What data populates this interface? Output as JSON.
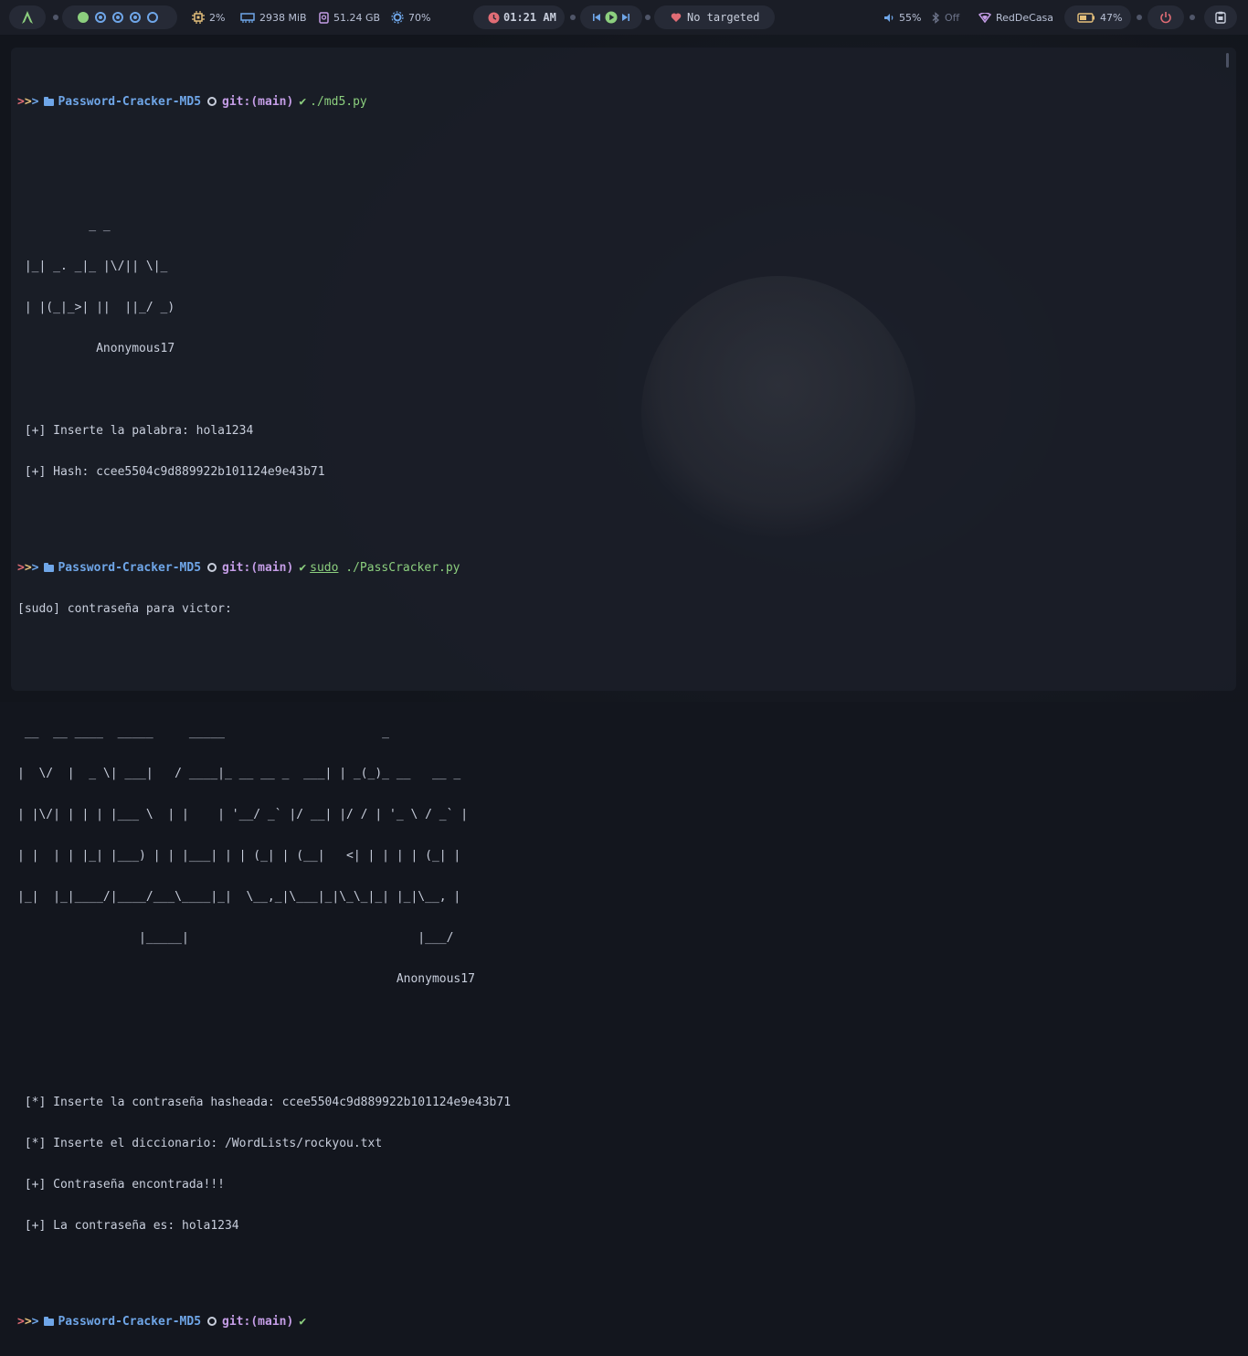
{
  "topbar": {
    "launcher_icon": "arch-logo-icon",
    "workspaces": [
      {
        "state": "active"
      },
      {
        "state": "occupied"
      },
      {
        "state": "occupied"
      },
      {
        "state": "occupied"
      },
      {
        "state": "empty"
      }
    ],
    "cpu": "2%",
    "memory": "2938 MiB",
    "disk": "51.24 GB",
    "brightness": "70%",
    "clock": "01:21 AM",
    "focused_window": "No targeted",
    "volume": "55%",
    "bluetooth": "Off",
    "network": "RedDeCasa",
    "battery": "47%",
    "colors": {
      "green": "#8ccf7e",
      "blue": "#6fa6e8",
      "red": "#e06c75",
      "yellow": "#e5c07b",
      "purple": "#c49de6"
    }
  },
  "terminal": {
    "prompt": {
      "arrows": [
        ">",
        ">",
        ">"
      ],
      "directory": "Password-Cracker-MD5",
      "git": "git:(main)"
    },
    "cmd1": "./md5.py",
    "md5_banner": [
      "          _ _",
      " |_| _. _|_ |\\/|| \\|_",
      " | |(_|_>| ||  ||_/ _)",
      "           Anonymous17"
    ],
    "md5_output": [
      " [+] Inserte la palabra: hola1234",
      " [+] Hash: ccee5504c9d889922b101124e9e43b71"
    ],
    "cmd2_sudo": "sudo",
    "cmd2_rest": "./PassCracker.py",
    "sudo_prompt": "[sudo] contraseña para victor:",
    "cracker_banner": [
      " __  __ ____  _____     _____                      _",
      "|  \\/  |  _ \\| ___|   / ____|_ __ __ _  ___| | _(_)_ __   __ _",
      "| |\\/| | | | |___ \\  | |    | '__/ _` |/ __| |/ / | '_ \\ / _` |",
      "| |  | | |_| |___) | | |___| | | (_| | (__|   <| | | | | (_| |",
      "|_|  |_|____/|____/___\\____|_|  \\__,_|\\___|_|\\_\\_|_| |_|\\__, |",
      "                 |_____|                                |___/",
      "                                                     Anonymous17"
    ],
    "cracker_output": [
      " [*] Inserte la contraseña hasheada: ccee5504c9d889922b101124e9e43b71",
      " [*] Inserte el diccionario: /WordLists/rockyou.txt",
      " [+] Contraseña encontrada!!!",
      " [+] La contraseña es: hola1234"
    ]
  }
}
